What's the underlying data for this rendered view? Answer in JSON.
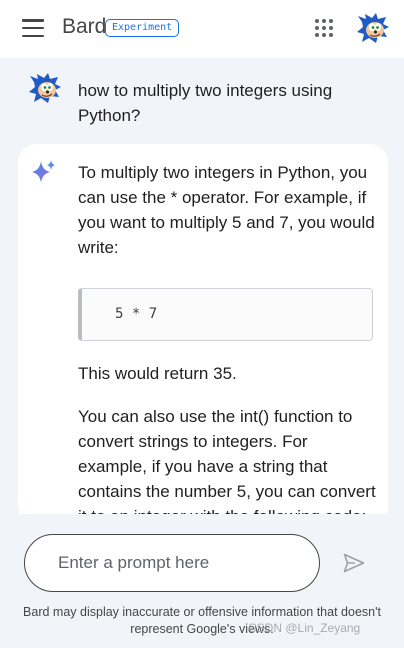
{
  "header": {
    "brand": "Bard",
    "badge": "Experiment",
    "menu_icon": "hamburger-menu-icon",
    "apps_icon": "apps-grid-icon",
    "avatar_icon": "sonic-avatar"
  },
  "conversation": {
    "user_prompt": "how to multiply two integers using Python?",
    "response": {
      "icon": "sparkle-icon",
      "intro": "To multiply two integers in Python, you can use the * operator. For example, if you want to multiply 5 and 7, you would write:",
      "code": "5 * 7",
      "result": "This would return 35.",
      "followup": "You can also use the int() function to convert strings to integers. For example, if you have a string that contains the number 5, you can convert it to an integer with the following code:"
    }
  },
  "input": {
    "placeholder": "Enter a prompt here",
    "value": "",
    "send_icon": "send-icon"
  },
  "disclaimer": "Bard may display inaccurate or offensive information that doesn't represent Google's views.",
  "watermark": "CSDN @Lin_Zeyang",
  "colors": {
    "background": "#f1f4f9",
    "surface": "#ffffff",
    "accent": "#1a73e8",
    "sparkle_blue": "#4285f4"
  }
}
